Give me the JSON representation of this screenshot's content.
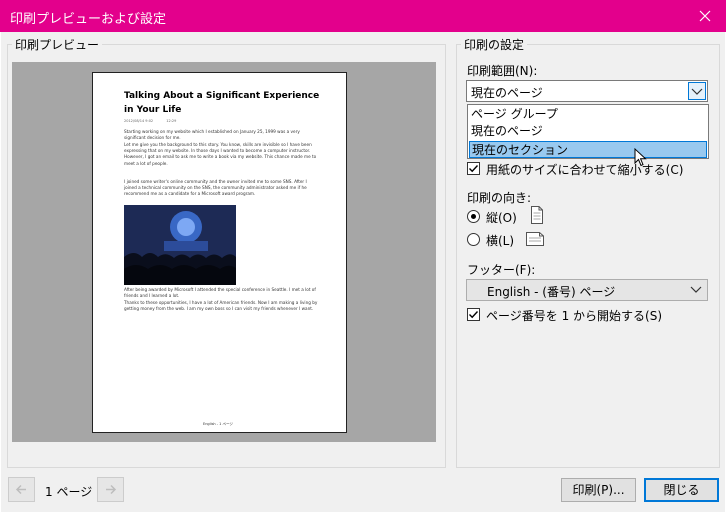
{
  "window": {
    "title": "印刷プレビューおよび設定"
  },
  "preview": {
    "group_label": "印刷プレビュー",
    "page": {
      "title": "Talking About a Significant Experience in Your Life",
      "date": "2012/08/14  9:02",
      "time": "12:29",
      "para1": "Starting working on my website which I established on January 25, 1999 was a very significant decision for me.",
      "para2": "Let me give you the background to this story. You know, skills are invisible so I have been expressing that on my website. In those days I wanted to become a computer instructor. However, I got an email to ask me to write a book via my website. This chance made me to meet a lot of people.",
      "para3": "I joined some writer's online community and the owner invited me to some SNS. After I joined a technical community on the SNS, the community administrator asked me if he recommend me as a candidate for a Microsoft award program.",
      "para4": "After being awarded by Microsoft I attended the special conference in Seattle. I met a lot of friends and I learned a lot.",
      "para5": "Thanks to these opportunities, I have a lot of American friends. Now I am making a living by getting money from the web. I am my own boss so I can visit my friends whenever I want.",
      "footer": "English - 1 ページ"
    }
  },
  "settings": {
    "group_label": "印刷の設定",
    "range_label": "印刷範囲(N):",
    "range_value": "現在のページ",
    "dropdown_items": [
      "ページ グループ",
      "現在のページ",
      "現在のセクション"
    ],
    "fit_label": "用紙のサイズに合わせて縮小する(C)",
    "orientation_label": "印刷の向き:",
    "portrait_label": "縦(O)",
    "landscape_label": "横(L)",
    "footer_label": "フッター(F):",
    "footer_value": "English - (番号) ページ",
    "page_number_label": "ページ番号を 1 から開始する(S)"
  },
  "bottom": {
    "page_indicator": "1 ページ",
    "print_button": "印刷(P)...",
    "close_button": "閉じる"
  },
  "colors": {
    "title_bar": "#e3008c",
    "selection": "#99c9ef",
    "accent": "#0078d7"
  },
  "icons": [
    "close-icon",
    "chevron-down-icon",
    "checkmark-icon",
    "portrait-page-icon",
    "landscape-page-icon",
    "arrow-left-icon",
    "arrow-right-icon",
    "mouse-cursor-icon"
  ]
}
